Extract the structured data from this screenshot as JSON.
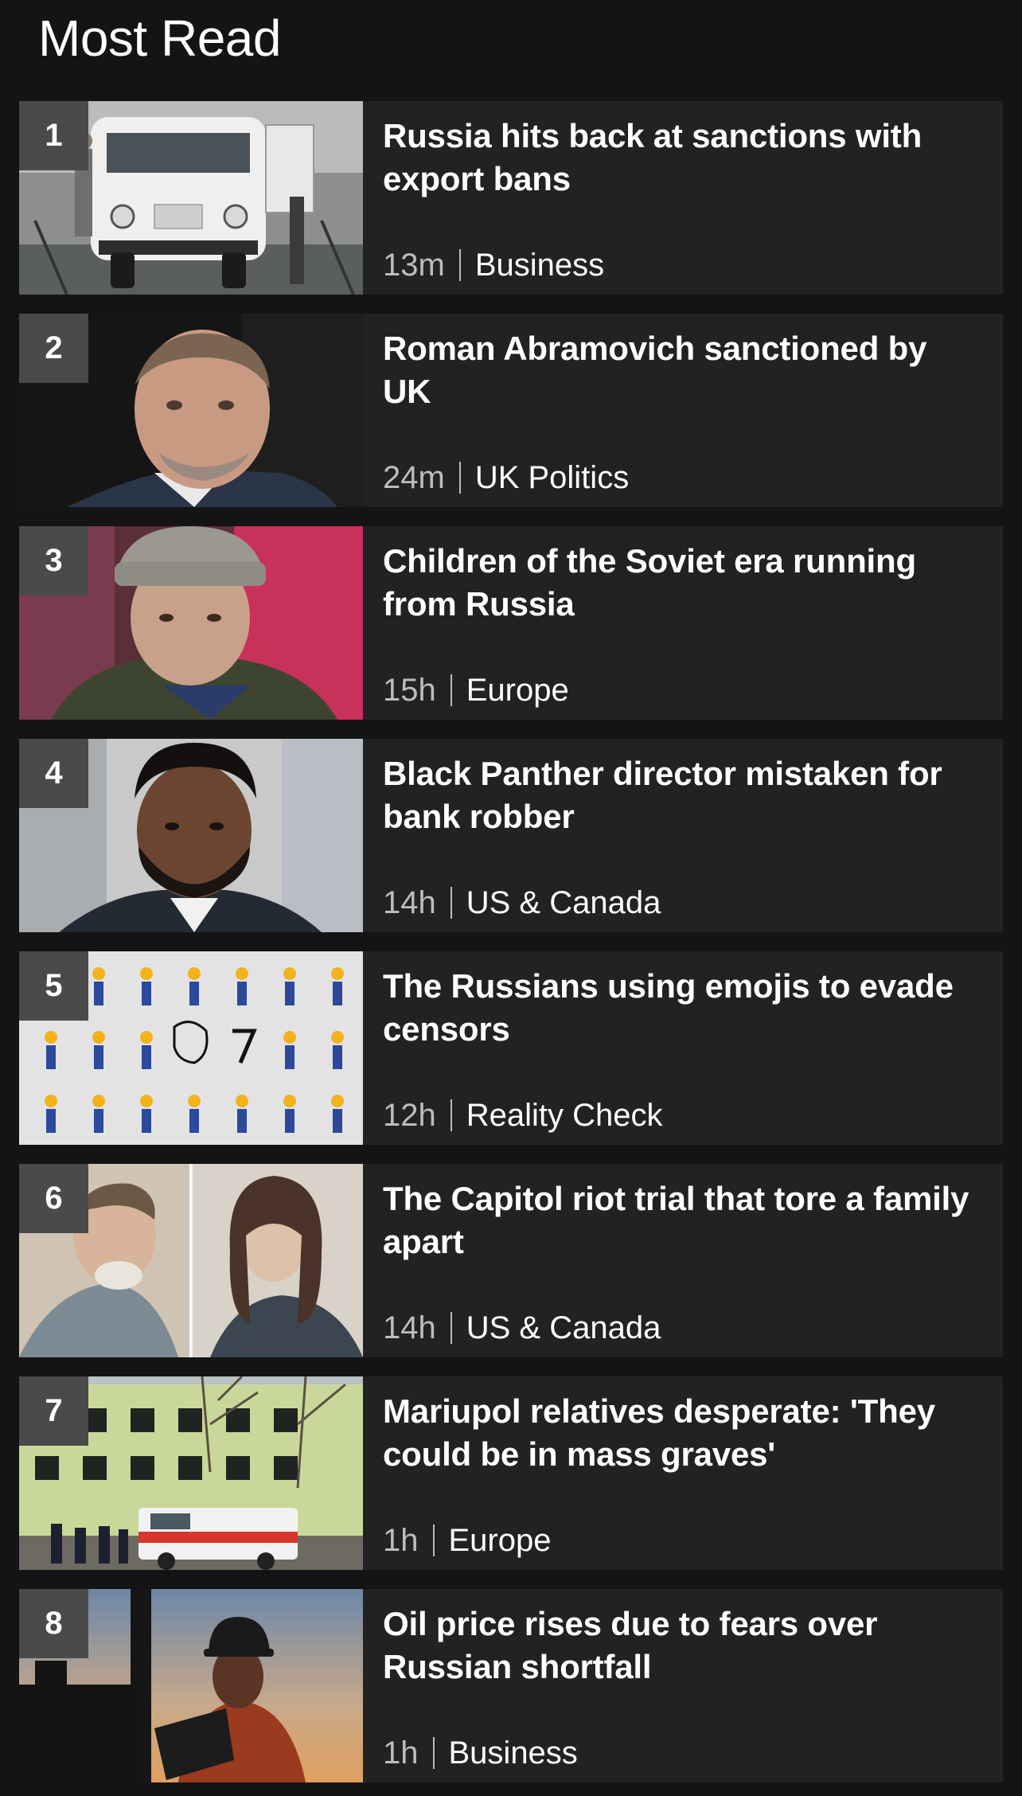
{
  "page": {
    "title": "Most Read"
  },
  "items": [
    {
      "rank": "1",
      "headline": "Russia hits back at sanctions with export bans",
      "time": "13m",
      "section": "Business",
      "image": "uaz-van-factory"
    },
    {
      "rank": "2",
      "headline": "Roman Abramovich sanctioned by UK",
      "time": "24m",
      "section": "UK Politics",
      "image": "abramovich-portrait"
    },
    {
      "rank": "3",
      "headline": "Children of the Soviet era running from Russia",
      "time": "15h",
      "section": "Europe",
      "image": "man-in-beanie"
    },
    {
      "rank": "4",
      "headline": "Black Panther director mistaken for bank robber",
      "time": "14h",
      "section": "US & Canada",
      "image": "director-portrait"
    },
    {
      "rank": "5",
      "headline": "The Russians using emojis to evade censors",
      "time": "12h",
      "section": "Reality Check",
      "image": "emoji-grid"
    },
    {
      "rank": "6",
      "headline": "The Capitol riot trial that tore a family apart",
      "time": "14h",
      "section": "US & Canada",
      "image": "courtroom-sketch"
    },
    {
      "rank": "7",
      "headline": "Mariupol relatives desperate: 'They could be in mass graves'",
      "time": "1h",
      "section": "Europe",
      "image": "damaged-building-fire-truck"
    },
    {
      "rank": "8",
      "headline": "Oil price rises due to fears over Russian shortfall",
      "time": "1h",
      "section": "Business",
      "image": "oil-worker-laptop"
    }
  ],
  "colors": {
    "background": "#141414",
    "card": "#222222",
    "rank_badge": "#4a4a4a",
    "meta_time": "#bdbdbd",
    "text": "#ffffff"
  }
}
